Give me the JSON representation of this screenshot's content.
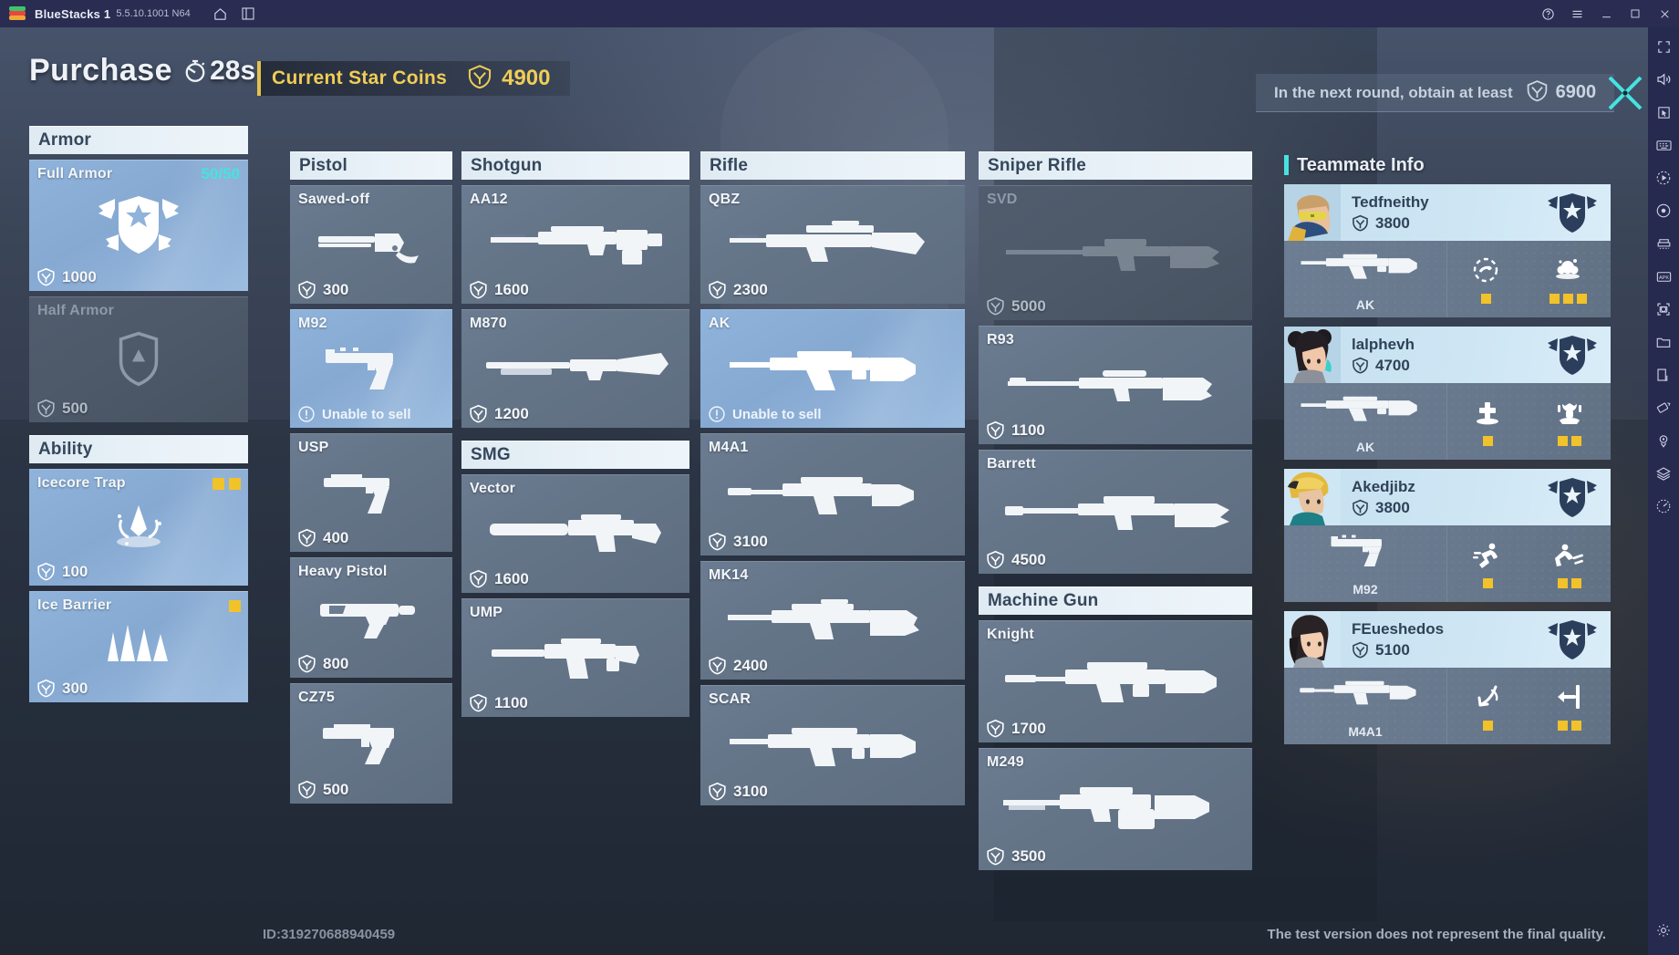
{
  "titlebar": {
    "app_name": "BlueStacks 1",
    "version": "5.5.10.1001 N64",
    "icons": [
      "home-icon",
      "multi-instance-icon"
    ],
    "window_controls": [
      "help-icon",
      "menu-icon",
      "minimize-icon",
      "maximize-icon",
      "close-icon"
    ]
  },
  "header": {
    "purchase_label": "Purchase",
    "timer": "28s",
    "coins_label": "Current Star Coins",
    "coins_value": "4900",
    "next_round_text": "In the next round, obtain at least",
    "next_round_value": "6900"
  },
  "colors": {
    "accent_cyan": "#46e3e0",
    "gold": "#f0cd55",
    "pip_yellow": "#f1c229",
    "header_blue": "#36475c",
    "selected_blue": "#8fb3da"
  },
  "categories": [
    {
      "name": "Armor",
      "items": [
        {
          "name": "Full Armor",
          "price": "1000",
          "hp": "50/50",
          "state": "selected",
          "art": "armor-full-icon"
        },
        {
          "name": "Half Armor",
          "price": "500",
          "state": "disabled",
          "art": "armor-half-icon"
        }
      ]
    },
    {
      "name": "Ability",
      "items": [
        {
          "name": "Icecore Trap",
          "price": "100",
          "state": "selected",
          "pips": 2,
          "art": "icecore-trap-icon"
        },
        {
          "name": "Ice Barrier",
          "price": "300",
          "state": "selected",
          "pips": 1,
          "art": "ice-barrier-icon"
        }
      ]
    },
    {
      "name": "Pistol",
      "items": [
        {
          "name": "Sawed-off",
          "price": "300",
          "state": "normal",
          "art": "sawed-off-icon"
        },
        {
          "name": "M92",
          "lock_text": "Unable to sell",
          "state": "selected",
          "art": "m92-icon"
        },
        {
          "name": "USP",
          "price": "400",
          "state": "normal",
          "art": "usp-icon"
        },
        {
          "name": "Heavy Pistol",
          "price": "800",
          "state": "normal",
          "art": "heavy-pistol-icon"
        },
        {
          "name": "CZ75",
          "price": "500",
          "state": "normal",
          "art": "cz75-icon"
        }
      ]
    },
    {
      "name": "Shotgun",
      "items": [
        {
          "name": "AA12",
          "price": "1600",
          "state": "normal",
          "art": "aa12-icon"
        },
        {
          "name": "M870",
          "price": "1200",
          "state": "normal",
          "art": "m870-icon"
        }
      ]
    },
    {
      "name": "SMG",
      "items": [
        {
          "name": "Vector",
          "price": "1600",
          "state": "normal",
          "art": "vector-icon"
        },
        {
          "name": "UMP",
          "price": "1100",
          "state": "normal",
          "art": "ump-icon"
        }
      ]
    },
    {
      "name": "Rifle",
      "items": [
        {
          "name": "QBZ",
          "price": "2300",
          "state": "normal",
          "art": "qbz-icon"
        },
        {
          "name": "AK",
          "lock_text": "Unable to sell",
          "state": "selected",
          "art": "ak-icon"
        },
        {
          "name": "M4A1",
          "price": "3100",
          "state": "normal",
          "art": "m4a1-icon"
        },
        {
          "name": "MK14",
          "price": "2400",
          "state": "normal",
          "art": "mk14-icon"
        },
        {
          "name": "SCAR",
          "price": "3100",
          "state": "normal",
          "art": "scar-icon"
        }
      ]
    },
    {
      "name": "Sniper Rifle",
      "items": [
        {
          "name": "SVD",
          "price": "5000",
          "state": "disabled",
          "art": "svd-icon"
        },
        {
          "name": "R93",
          "price": "1100",
          "state": "normal",
          "art": "r93-icon"
        },
        {
          "name": "Barrett",
          "price": "4500",
          "state": "normal",
          "art": "barrett-icon"
        }
      ]
    },
    {
      "name": "Machine Gun",
      "items": [
        {
          "name": "Knight",
          "price": "1700",
          "state": "normal",
          "art": "knight-icon"
        },
        {
          "name": "M249",
          "price": "3500",
          "state": "normal",
          "art": "m249-icon"
        }
      ]
    }
  ],
  "teammate_panel": {
    "title": "Teammate Info",
    "members": [
      {
        "name": "Tedfneithy",
        "coins": "3800",
        "weapon": "AK",
        "abilities": [
          {
            "icon": "shockwave-icon",
            "pips": 1
          },
          {
            "icon": "smoke-icon",
            "pips": 3
          }
        ]
      },
      {
        "name": "lalphevh",
        "coins": "4700",
        "weapon": "AK",
        "abilities": [
          {
            "icon": "heal-icon",
            "pips": 1
          },
          {
            "icon": "turret-icon",
            "pips": 2
          }
        ]
      },
      {
        "name": "Akedjibz",
        "coins": "3800",
        "weapon": "M92",
        "abilities": [
          {
            "icon": "dash-icon",
            "pips": 1
          },
          {
            "icon": "slide-icon",
            "pips": 2
          }
        ]
      },
      {
        "name": "FEueshedos",
        "coins": "5100",
        "weapon": "M4A1",
        "abilities": [
          {
            "icon": "hook-icon",
            "pips": 1
          },
          {
            "icon": "barrier-icon",
            "pips": 2
          }
        ]
      }
    ]
  },
  "footer": {
    "id": "ID:319270688940459",
    "note": "The test version does not represent the final quality."
  }
}
